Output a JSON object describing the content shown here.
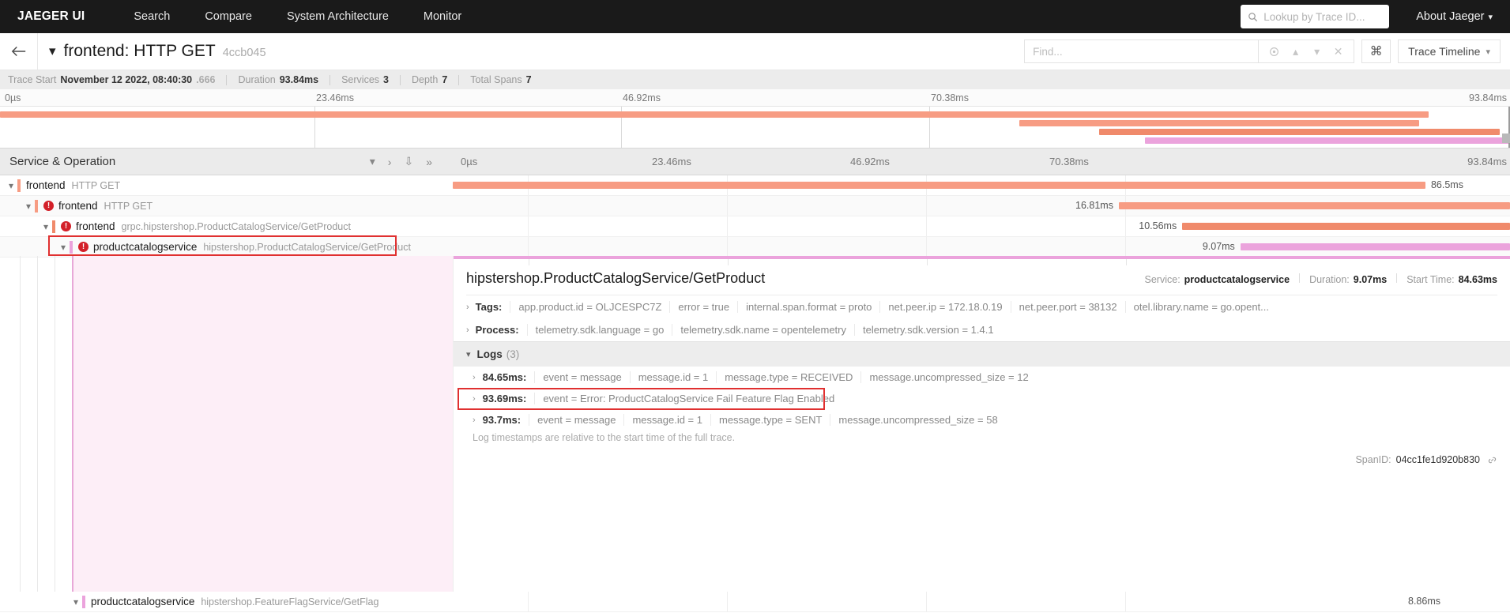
{
  "nav": {
    "brand": "JAEGER UI",
    "links": [
      "Search",
      "Compare",
      "System Architecture",
      "Monitor"
    ],
    "trace_lookup_placeholder": "Lookup by Trace ID...",
    "about_label": "About Jaeger",
    "search_icon": "search-icon",
    "caret_icon": "chevron-down-icon"
  },
  "titlebar": {
    "back_icon": "arrow-left-icon",
    "caret_icon": "chevron-down-icon",
    "title": "frontend: HTTP GET",
    "short_id": "4ccb045",
    "find_placeholder": "Find...",
    "find_value": "",
    "controls": [
      "focus-icon",
      "chevron-up-icon",
      "chevron-down-icon",
      "close-icon"
    ],
    "kbd_label": "⌘",
    "view_mode": "Trace Timeline"
  },
  "stats": {
    "trace_start_label": "Trace Start",
    "trace_start_value": "November 12 2022, 08:40:30",
    "trace_start_frac": ".666",
    "duration_label": "Duration",
    "duration_value": "93.84ms",
    "services_label": "Services",
    "services_value": "3",
    "depth_label": "Depth",
    "depth_value": "7",
    "total_spans_label": "Total Spans",
    "total_spans_value": "7"
  },
  "minimap": {
    "ticks": [
      "0µs",
      "23.46ms",
      "46.92ms",
      "70.38ms",
      "93.84ms"
    ],
    "bars": [
      {
        "start_pct": 0.0,
        "width_pct": 94.6,
        "color": "#f79c83"
      },
      {
        "start_pct": 67.5,
        "width_pct": 26.5,
        "color": "#f79c83"
      },
      {
        "start_pct": 72.8,
        "width_pct": 26.5,
        "color": "#f08a6b"
      },
      {
        "start_pct": 75.8,
        "width_pct": 24.2,
        "color": "#eba3dc"
      }
    ]
  },
  "columns": {
    "service_operation": "Service & Operation",
    "header_icons": [
      "chevron-down-icon",
      "chevron-right-icon",
      "chevrons-down-icon",
      "chevrons-right-icon"
    ],
    "ticks": [
      "0µs",
      "23.46ms",
      "46.92ms",
      "70.38ms",
      "93.84ms"
    ]
  },
  "spans": [
    {
      "depth": 0,
      "service": "frontend",
      "operation": "HTTP GET",
      "error": false,
      "color": "#f79c83",
      "caret": "chevron-down-icon",
      "bar_start_pct": 0.0,
      "bar_width_pct": 92.0,
      "label": "86.5ms",
      "label_side": "right",
      "selected": false
    },
    {
      "depth": 1,
      "service": "frontend",
      "operation": "HTTP GET",
      "error": true,
      "color": "#f79c83",
      "caret": "chevron-down-icon",
      "bar_start_pct": 63.0,
      "bar_width_pct": 37.0,
      "label": "16.81ms",
      "label_side": "left",
      "selected": false
    },
    {
      "depth": 2,
      "service": "frontend",
      "operation": "grpc.hipstershop.ProductCatalogService/GetProduct",
      "error": true,
      "color": "#f08a6b",
      "caret": "chevron-down-icon",
      "bar_start_pct": 69.0,
      "bar_width_pct": 31.0,
      "label": "10.56ms",
      "label_side": "left",
      "selected": false
    },
    {
      "depth": 3,
      "service": "productcatalogservice",
      "operation": "hipstershop.ProductCatalogService/GetProduct",
      "error": true,
      "color": "#eba3dc",
      "caret": "chevron-down-icon",
      "bar_start_pct": 74.5,
      "bar_width_pct": 25.5,
      "label": "9.07ms",
      "label_side": "left",
      "selected": true
    }
  ],
  "bottom_span": {
    "depth": 4,
    "service": "productcatalogservice",
    "operation": "hipstershop.FeatureFlagService/GetFlag",
    "error": false,
    "caret": "chevron-down-icon",
    "label": "8.86ms"
  },
  "detail": {
    "operation": "hipstershop.ProductCatalogService/GetProduct",
    "service_label": "Service:",
    "service_value": "productcatalogservice",
    "duration_label": "Duration:",
    "duration_value": "9.07ms",
    "start_time_label": "Start Time:",
    "start_time_value": "84.63ms",
    "tags_label": "Tags:",
    "tags": [
      "app.product.id = OLJCESPC7Z",
      "error = true",
      "internal.span.format = proto",
      "net.peer.ip = 172.18.0.19",
      "net.peer.port = 38132",
      "otel.library.name = go.opent..."
    ],
    "process_label": "Process:",
    "process": [
      "telemetry.sdk.language = go",
      "telemetry.sdk.name = opentelemetry",
      "telemetry.sdk.version = 1.4.1"
    ],
    "logs_label": "Logs",
    "logs_count": "(3)",
    "logs": [
      {
        "timestamp": "84.65ms:",
        "fields": [
          "event = message",
          "message.id = 1",
          "message.type = RECEIVED",
          "message.uncompressed_size = 12"
        ],
        "highlighted": false
      },
      {
        "timestamp": "93.69ms:",
        "fields": [
          "event = Error: ProductCatalogService Fail Feature Flag Enabled"
        ],
        "highlighted": true
      },
      {
        "timestamp": "93.7ms:",
        "fields": [
          "event = message",
          "message.id = 1",
          "message.type = SENT",
          "message.uncompressed_size = 58"
        ],
        "highlighted": false
      }
    ],
    "logs_note": "Log timestamps are relative to the start time of the full trace.",
    "spanid_label": "SpanID:",
    "spanid_value": "04cc1fe1d920b830",
    "link_icon": "link-icon"
  }
}
